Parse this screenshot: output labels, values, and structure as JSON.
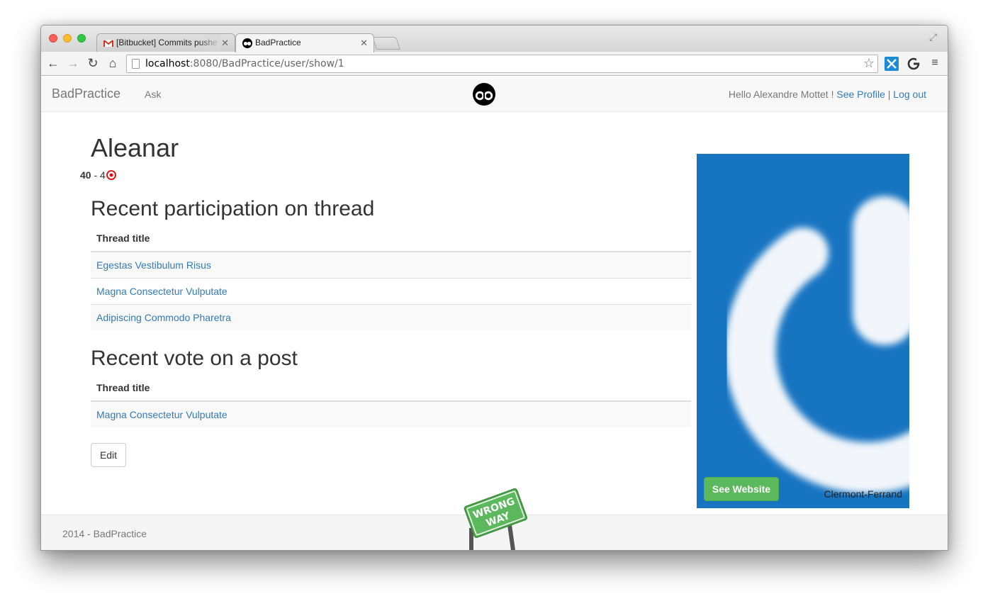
{
  "browser": {
    "tabs": [
      {
        "title": "[Bitbucket] Commits pushe",
        "favicon": "gmail-icon"
      },
      {
        "title": "BadPractice",
        "favicon": "badpractice-logo-icon"
      }
    ],
    "address": {
      "host": "localhost",
      "rest": ":8080/BadPractice/user/show/1"
    }
  },
  "navbar": {
    "brand": "BadPractice",
    "ask": "Ask",
    "greeting": "Hello Alexandre Mottet !",
    "see_profile": "See Profile",
    "separator": "|",
    "logout": "Log out"
  },
  "profile": {
    "name": "Aleanar",
    "score_left": "40",
    "score_sep": " - ",
    "score_right": "4"
  },
  "participation": {
    "heading": "Recent participation on thread",
    "column": "Thread title",
    "rows": [
      "Egestas Vestibulum Risus",
      "Magna Consectetur Vulputate",
      "Adipiscing Commodo Pharetra"
    ]
  },
  "votes": {
    "heading": "Recent vote on a post",
    "column": "Thread title",
    "rows": [
      "Magna Consectetur Vulputate"
    ]
  },
  "actions": {
    "edit": "Edit"
  },
  "sidebar": {
    "button": "See Website",
    "city": "Clermont-Ferrand",
    "accent": "#1774c1"
  },
  "footer": {
    "text": "2014 - BadPractice",
    "sign_line1": "WRONG",
    "sign_line2": "WAY"
  }
}
